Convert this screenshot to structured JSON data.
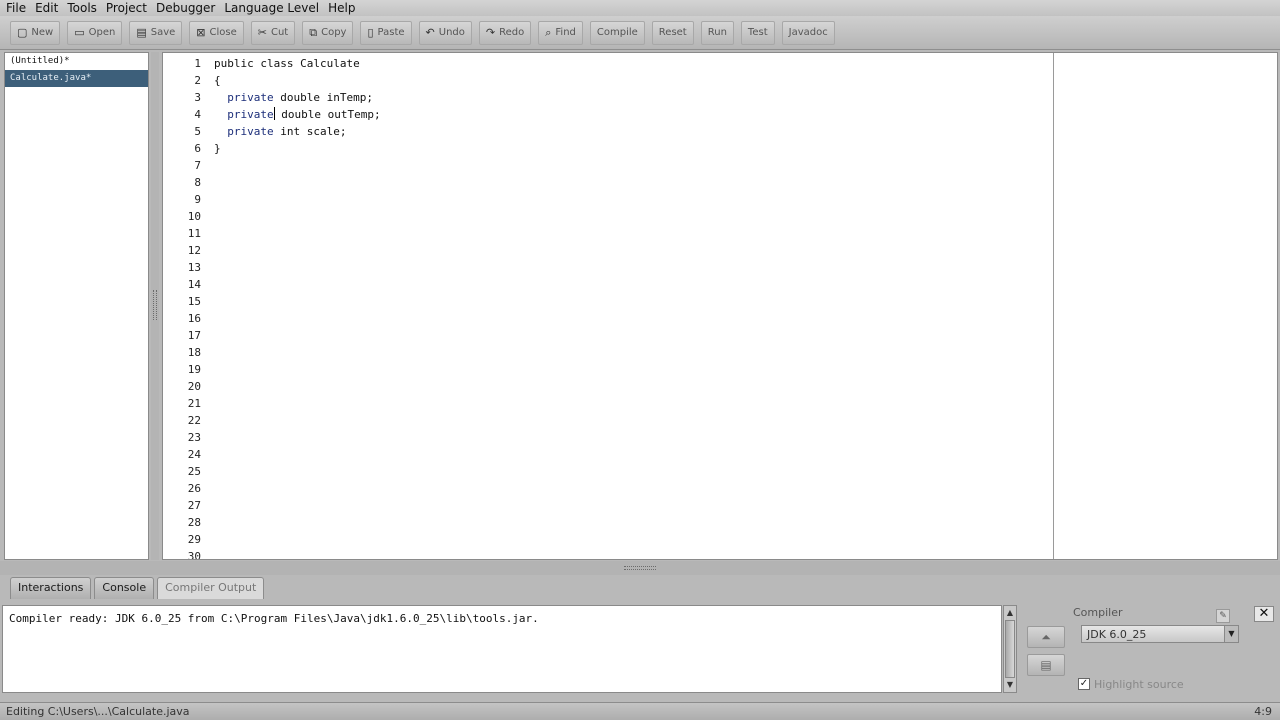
{
  "menu": [
    "File",
    "Edit",
    "Tools",
    "Project",
    "Debugger",
    "Language Level",
    "Help"
  ],
  "toolbar": [
    {
      "label": "New",
      "icon": "new-file-icon",
      "glyph": "▢"
    },
    {
      "label": "Open",
      "icon": "open-folder-icon",
      "glyph": "▭"
    },
    {
      "label": "Save",
      "icon": "save-icon",
      "glyph": "▤"
    },
    {
      "label": "Close",
      "icon": "close-file-icon",
      "glyph": "⊠"
    },
    {
      "label": "Cut",
      "icon": "cut-icon",
      "glyph": "✂"
    },
    {
      "label": "Copy",
      "icon": "copy-icon",
      "glyph": "⧉"
    },
    {
      "label": "Paste",
      "icon": "paste-icon",
      "glyph": "▯"
    },
    {
      "label": "Undo",
      "icon": "undo-icon",
      "glyph": "↶"
    },
    {
      "label": "Redo",
      "icon": "redo-icon",
      "glyph": "↷"
    },
    {
      "label": "Find",
      "icon": "find-icon",
      "glyph": "⌕"
    },
    {
      "label": "Compile",
      "icon": "compile-icon",
      "glyph": ""
    },
    {
      "label": "Reset",
      "icon": "reset-icon",
      "glyph": ""
    },
    {
      "label": "Run",
      "icon": "run-icon",
      "glyph": ""
    },
    {
      "label": "Test",
      "icon": "test-icon",
      "glyph": ""
    },
    {
      "label": "Javadoc",
      "icon": "javadoc-icon",
      "glyph": ""
    }
  ],
  "files": [
    {
      "name": "(Untitled)*",
      "selected": false
    },
    {
      "name": "Calculate.java*",
      "selected": true
    }
  ],
  "editor": {
    "code_lines": [
      [
        {
          "t": "public class Calculate",
          "k": false
        }
      ],
      [
        {
          "t": "{",
          "k": false
        }
      ],
      [
        {
          "t": "  private ",
          "k": true
        },
        {
          "t": "double inTemp;",
          "k": false
        }
      ],
      [
        {
          "t": "  private",
          "k": true
        },
        {
          "t": "|",
          "caret": true
        },
        {
          "t": " double outTemp;",
          "k": false
        }
      ],
      [
        {
          "t": "  private ",
          "k": true
        },
        {
          "t": "int scale;",
          "k": false
        }
      ],
      [
        {
          "t": "}",
          "k": false
        }
      ]
    ],
    "line_count": 30
  },
  "bottom_tabs": [
    {
      "label": "Interactions",
      "active": false
    },
    {
      "label": "Console",
      "active": false
    },
    {
      "label": "Compiler Output",
      "active": true
    }
  ],
  "output_text": "Compiler ready: JDK 6.0_25 from C:\\Program Files\\Java\\jdk1.6.0_25\\lib\\tools.jar.",
  "compiler": {
    "label": "Compiler",
    "selected": "JDK 6.0_25",
    "option_label": "Highlight source"
  },
  "status": {
    "message": "Editing C:\\Users\\...\\Calculate.java",
    "position": "4:9"
  }
}
